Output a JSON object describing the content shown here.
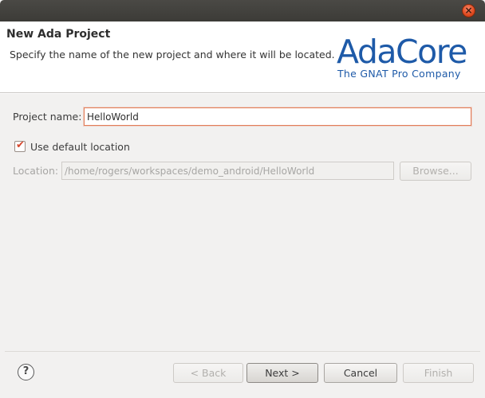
{
  "header": {
    "title": "New Ada Project",
    "description": "Specify the name of the new project and where it will be located.",
    "logo_main": "AdaCore",
    "logo_sub": "The GNAT Pro Company"
  },
  "form": {
    "project_name_label": "Project name:",
    "project_name_value": "HelloWorld",
    "use_default_label": "Use default location",
    "use_default_checked": true,
    "location_label": "Location:",
    "location_value": "/home/rogers/workspaces/demo_android/HelloWorld",
    "browse_label": "Browse..."
  },
  "footer": {
    "back_label": "< Back",
    "next_label": "Next >",
    "cancel_label": "Cancel",
    "finish_label": "Finish"
  },
  "colors": {
    "logo_blue": "#1e5aa8",
    "focus_border": "#e27d58",
    "check_red": "#d6472d"
  }
}
